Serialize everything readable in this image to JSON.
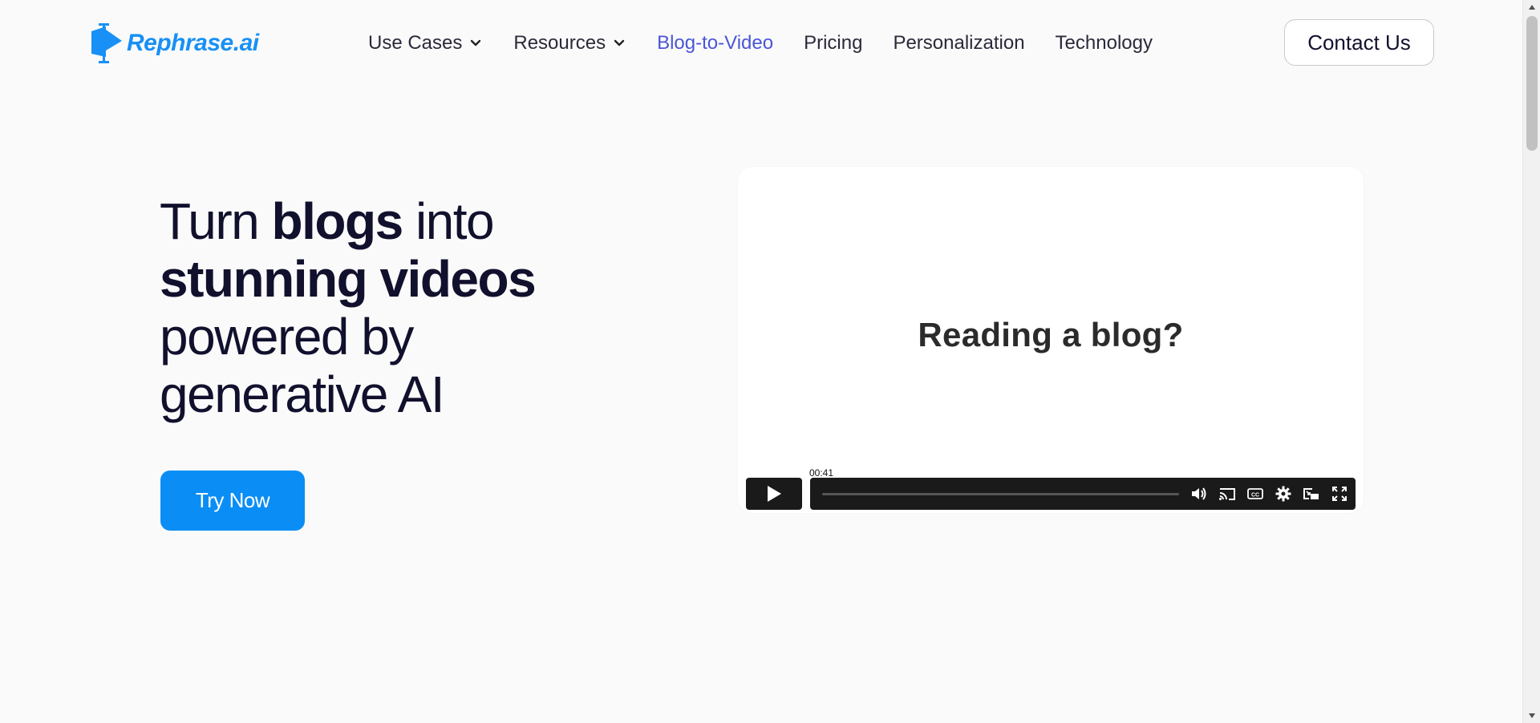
{
  "header": {
    "logo_text": "Rephrase.ai",
    "nav": [
      {
        "label": "Use Cases",
        "dropdown": true,
        "active": false
      },
      {
        "label": "Resources",
        "dropdown": true,
        "active": false
      },
      {
        "label": "Blog-to-Video",
        "dropdown": false,
        "active": true
      },
      {
        "label": "Pricing",
        "dropdown": false,
        "active": false
      },
      {
        "label": "Personalization",
        "dropdown": false,
        "active": false
      },
      {
        "label": "Technology",
        "dropdown": false,
        "active": false
      }
    ],
    "contact_label": "Contact Us"
  },
  "hero": {
    "line1_pre": "Turn ",
    "line1_bold": "blogs",
    "line1_post": " into",
    "line2_bold": "stunning videos",
    "line3": "powered by",
    "line4": "generative AI",
    "cta_label": "Try Now"
  },
  "video": {
    "caption": "Reading a blog?",
    "time_tooltip": "00:41",
    "progress": 0,
    "controls": [
      "volume-icon",
      "cast-icon",
      "captions-icon",
      "settings-icon",
      "picture-in-picture-icon",
      "fullscreen-icon"
    ]
  },
  "colors": {
    "brand": "#1890f5",
    "cta": "#0a8ef5",
    "nav_active": "#4a56d6",
    "text": "#11112e",
    "background": "#fafafa"
  }
}
